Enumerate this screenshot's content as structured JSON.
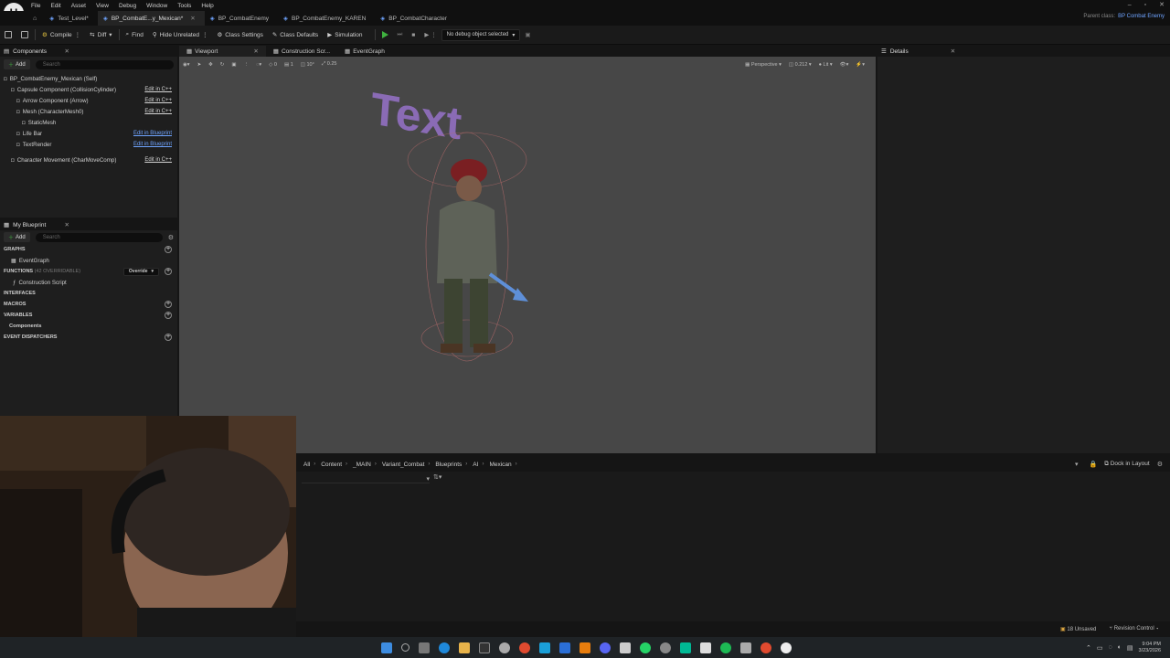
{
  "menu": [
    "File",
    "Edit",
    "Asset",
    "View",
    "Debug",
    "Window",
    "Tools",
    "Help"
  ],
  "tabs": [
    {
      "label": "Test_Level*",
      "active": false
    },
    {
      "label": "BP_CombatE...y_Mexican*",
      "active": true
    },
    {
      "label": "BP_CombatEnemy",
      "active": false
    },
    {
      "label": "BP_CombatEnemy_KAREN",
      "active": false
    },
    {
      "label": "BP_CombatCharacter",
      "active": false
    }
  ],
  "parent_class": {
    "label": "Parent class:",
    "value": "BP Combat Enemy"
  },
  "toolbar": {
    "compile": "Compile",
    "diff": "Diff",
    "find": "Find",
    "hide_unrelated": "Hide Unrelated",
    "class_settings": "Class Settings",
    "class_defaults": "Class Defaults",
    "simulation": "Simulation",
    "debug_select": "No debug object selected"
  },
  "components_panel": {
    "title": "Components",
    "add": "Add",
    "search_placeholder": "Search",
    "items": [
      {
        "label": "BP_CombatEnemy_Mexican (Self)",
        "edit": ""
      },
      {
        "label": "Capsule Component (CollisionCylinder)",
        "edit": "Edit in C++"
      },
      {
        "label": "Arrow Component (Arrow)",
        "edit": "Edit in C++"
      },
      {
        "label": "Mesh (CharacterMesh0)",
        "edit": "Edit in C++"
      },
      {
        "label": "StaticMesh",
        "edit": ""
      },
      {
        "label": "Life Bar",
        "edit": "Edit in Blueprint"
      },
      {
        "label": "TextRender",
        "edit": "Edit in Blueprint"
      },
      {
        "label": "Character Movement (CharMoveComp)",
        "edit": "Edit in C++"
      }
    ]
  },
  "my_blueprint": {
    "title": "My Blueprint",
    "add": "Add",
    "search_placeholder": "Search",
    "graphs": "GRAPHS",
    "event_graph": "EventGraph",
    "functions": "FUNCTIONS",
    "functions_count": "(42 OVERRIDABLE)",
    "override": "Override",
    "construction_script": "Construction Script",
    "interfaces": "INTERFACES",
    "macros": "MACROS",
    "variables": "VARIABLES",
    "components": "Components",
    "event_dispatchers": "EVENT DISPATCHERS"
  },
  "viewport_tabs": [
    {
      "label": "Viewport",
      "active": true
    },
    {
      "label": "Construction Scr...",
      "active": false
    },
    {
      "label": "EventGraph",
      "active": false
    }
  ],
  "viewport_tools": {
    "angle": "10°",
    "scale": "0.25",
    "view_mode": "Perspective",
    "fov": "0.212",
    "lit": "Lit",
    "nums": [
      "0",
      "1"
    ]
  },
  "viewport_text": "Text",
  "details": {
    "title": "Details"
  },
  "breadcrumb": [
    "All",
    "Content",
    "_MAIN",
    "Variant_Combat",
    "Blueprints",
    "AI",
    "Mexican"
  ],
  "dock_in_layout": "Dock in Layout",
  "status": {
    "unsaved": "18 Unsaved",
    "revision": "Revision Control"
  },
  "clock": {
    "time": "9:04 PM",
    "date": "3/23/2026"
  },
  "colors": {
    "accent": "#3fb23f",
    "link": "#6fa4ff",
    "text_render": "#8a6bb5"
  }
}
